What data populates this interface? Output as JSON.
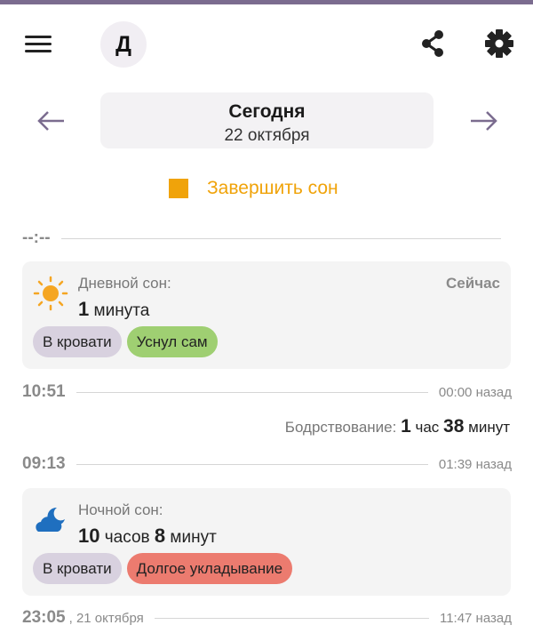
{
  "colors": {
    "accent": "#7b6c8f",
    "finish": "#f0a30a",
    "chip_lilac": "#d8d1df",
    "chip_green": "#9fcf72",
    "chip_red": "#ec7b6f"
  },
  "header": {
    "avatar_letter": "Д",
    "icons": [
      "menu-icon",
      "share-icon",
      "gear-icon"
    ]
  },
  "date_nav": {
    "title": "Сегодня",
    "date": "22 октября",
    "prev_icon": "arrow-left-icon",
    "next_icon": "arrow-right-icon"
  },
  "finish_sleep": {
    "label": "Завершить сон",
    "icon": "stop-square-icon"
  },
  "timeline": {
    "top_time": "--:--",
    "rows": [
      {
        "time": "10:51",
        "ago": "00:00 назад"
      },
      {
        "time": "09:13",
        "ago": "01:39 назад"
      },
      {
        "time": "23:05",
        "date_suffix": ", 21 октября",
        "ago": "11:47 назад"
      }
    ]
  },
  "cards": [
    {
      "icon": "sun-icon",
      "type": "Дневной сон:",
      "status": "Сейчас",
      "duration": {
        "hours": "",
        "hours_unit": "",
        "minutes": "1",
        "minutes_unit": "минута"
      },
      "tags": [
        "В кровати",
        "Уснул сам"
      ]
    },
    {
      "icon": "moon-cloud-icon",
      "type": "Ночной сон:",
      "status": "",
      "duration": {
        "hours": "10",
        "hours_unit": "часов",
        "minutes": "8",
        "minutes_unit": "минут"
      },
      "tags": [
        "В кровати",
        "Долгое укладывание"
      ]
    }
  ],
  "awake": {
    "label": "Бодрствование:",
    "hours": "1",
    "hours_unit": "час",
    "minutes": "38",
    "minutes_unit": "минут"
  }
}
